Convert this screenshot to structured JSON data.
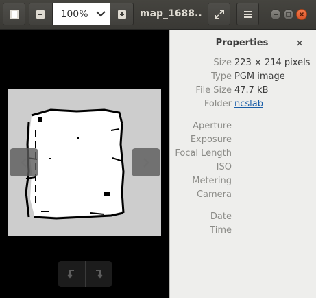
{
  "header": {
    "zoom_value": "100%",
    "title": "map_1688...",
    "icons": {
      "sidebar": "sidebar-toggle-icon",
      "zoom_out": "minus-icon",
      "zoom_in": "plus-icon",
      "dropdown": "chevron-down-icon",
      "fullscreen": "fullscreen-icon",
      "menu": "hamburger-menu-icon"
    }
  },
  "viewer": {
    "background": "#000000",
    "image_background": "#cdcdcd"
  },
  "properties": {
    "title": "Properties",
    "close": "×",
    "rows": [
      {
        "label": "Size",
        "value": "223 × 214 pixels"
      },
      {
        "label": "Type",
        "value": "PGM image"
      },
      {
        "label": "File Size",
        "value": "47.7 kB"
      },
      {
        "label": "Folder",
        "value": "ncslab"
      }
    ],
    "camera_labels": [
      "Aperture",
      "Exposure",
      "Focal Length",
      "ISO",
      "Metering",
      "Camera"
    ],
    "date_labels": [
      "Date",
      "Time"
    ]
  },
  "colors": {
    "header": "#3f3e3a",
    "panel": "#eeeeec",
    "accent_close": "#e5612f",
    "link": "#1a5ea8"
  }
}
